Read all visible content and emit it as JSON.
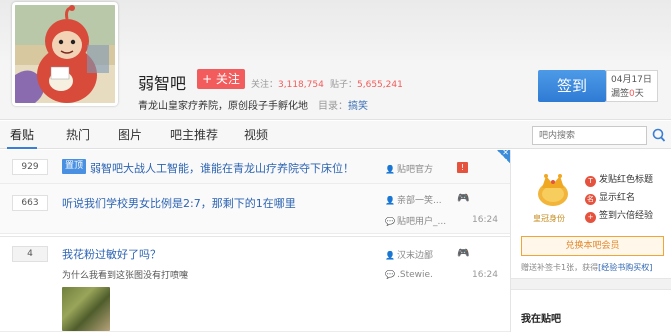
{
  "header": {
    "forum_name": "弱智吧",
    "follow_label": "+ 关注",
    "follow_count_label": "关注：",
    "follow_count": "3,118,754",
    "post_count_label": "贴子：",
    "post_count": "5,655,241",
    "slogan": "青龙山皇家疗养院，原创段子手孵化地",
    "catalog_label": "目录：",
    "catalog_value": "搞笑",
    "signin_label": "签到",
    "signin_date": "04月17日",
    "signin_streak_prefix": "漏签",
    "signin_streak_value": "0",
    "signin_streak_suffix": "天"
  },
  "nav": {
    "tabs": [
      "看贴",
      "热门",
      "图片",
      "吧主推荐",
      "视频"
    ],
    "search_placeholder": "吧内搜索"
  },
  "threads": [
    {
      "replies": "929",
      "tag": "置顶",
      "title": "弱智吧大战人工智能，谁能在青龙山疗养院夺下床位！",
      "author": "贴吧官方"
    },
    {
      "replies": "663",
      "title": "听说我们学校男女比例是2:7，那剩下的1在哪里",
      "author": "亲部一笑...",
      "last_reply": "贴吧用户_...",
      "time": "16:24"
    },
    {
      "replies": "4",
      "title": "我花粉过敏好了吗？",
      "abstract": "为什么我看到这张图没有打喷嚏",
      "author": "汉末边鄙",
      "last_reply": ".Stewie.",
      "time": "16:24"
    }
  ],
  "sidebar": {
    "crown_label": "皇冠身份",
    "perks": [
      "发贴红色标题",
      "显示红名",
      "签到六倍经验"
    ],
    "member_button": "兑换本吧会员",
    "gift_text": "赠送补签卡1张，获得",
    "gift_link": "[经验书购买权]",
    "section_title": "我在贴吧"
  }
}
